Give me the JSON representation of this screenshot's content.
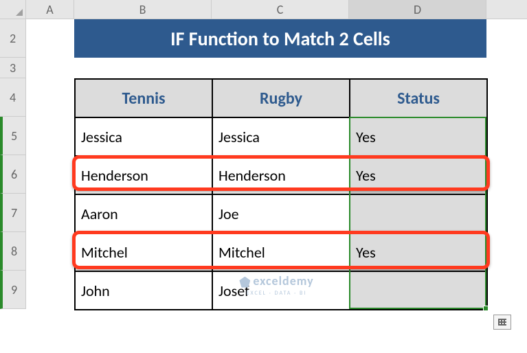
{
  "columns": [
    "A",
    "B",
    "C",
    "D"
  ],
  "rows": [
    "2",
    "3",
    "4",
    "5",
    "6",
    "7",
    "8",
    "9"
  ],
  "title": "IF Function to Match 2 Cells",
  "headers": {
    "tennis": "Tennis",
    "rugby": "Rugby",
    "status": "Status"
  },
  "data": [
    {
      "tennis": "Jessica",
      "rugby": "Jessica",
      "status": "Yes"
    },
    {
      "tennis": "Henderson",
      "rugby": "Henderson",
      "status": "Yes"
    },
    {
      "tennis": "Aaron",
      "rugby": "Joe",
      "status": ""
    },
    {
      "tennis": "Mitchel",
      "rugby": "Mitchel",
      "status": "Yes"
    },
    {
      "tennis": "John",
      "rugby": "Josef",
      "status": ""
    }
  ],
  "watermark": {
    "main": "exceldemy",
    "sub": "EXCEL · DATA · BI"
  },
  "chart_data": {
    "type": "table",
    "title": "IF Function to Match 2 Cells",
    "columns": [
      "Tennis",
      "Rugby",
      "Status"
    ],
    "rows": [
      [
        "Jessica",
        "Jessica",
        "Yes"
      ],
      [
        "Henderson",
        "Henderson",
        "Yes"
      ],
      [
        "Aaron",
        "Joe",
        ""
      ],
      [
        "Mitchel",
        "Mitchel",
        "Yes"
      ],
      [
        "John",
        "Josef",
        ""
      ]
    ],
    "highlighted_rows": [
      2,
      4
    ],
    "selected_range": "D5:D9"
  }
}
